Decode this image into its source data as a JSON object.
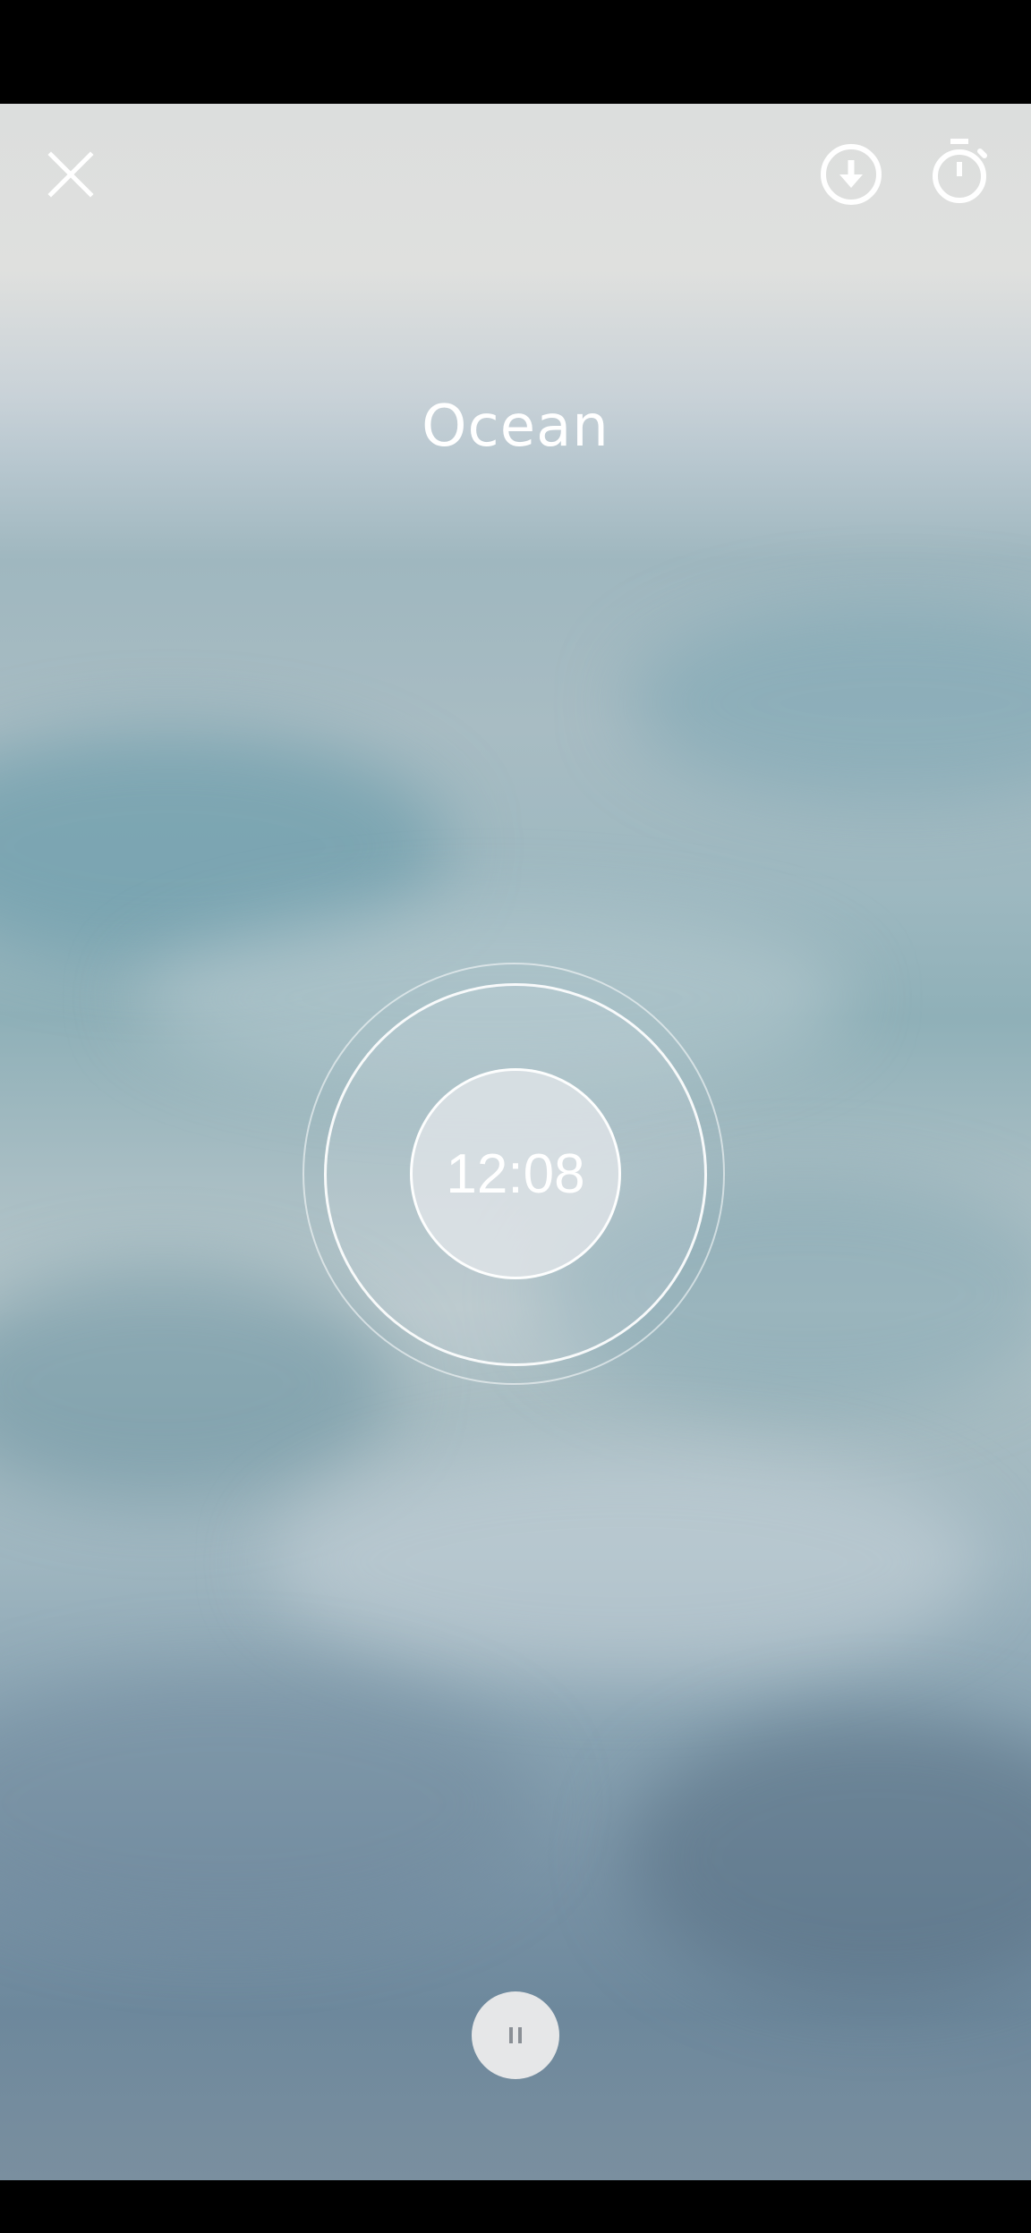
{
  "player": {
    "title": "Ocean",
    "timer": "12:08"
  },
  "icons": {
    "close": "close-icon",
    "download": "download-icon",
    "timer": "stopwatch-icon",
    "pause": "pause-icon"
  },
  "colors": {
    "icon": "#ffffff",
    "pause_button_bg": "#e6e7e8",
    "pause_glyph": "#8a8f95"
  }
}
